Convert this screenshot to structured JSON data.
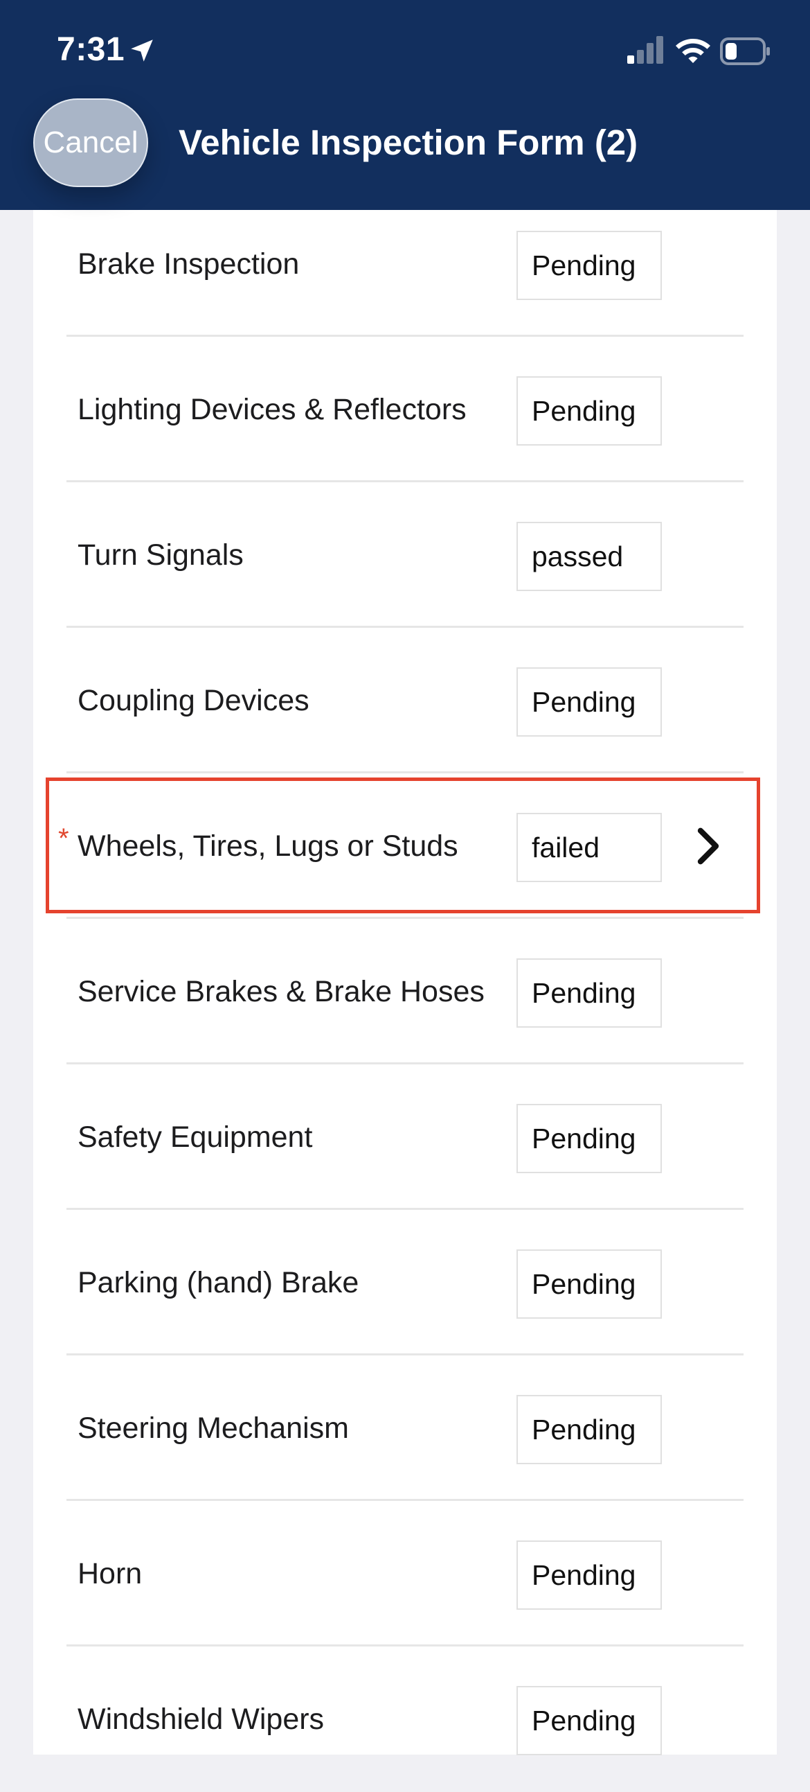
{
  "status_bar": {
    "time": "7:31",
    "icons": [
      "location-arrow-icon",
      "cellular-signal-icon",
      "wifi-icon",
      "battery-icon"
    ]
  },
  "header": {
    "cancel_label": "Cancel",
    "title": "Vehicle Inspection Form (2)",
    "background_color": "#122f5e"
  },
  "items": [
    {
      "label": "Brake Inspection",
      "status": "Pending"
    },
    {
      "label": "Lighting Devices & Reflectors",
      "status": "Pending"
    },
    {
      "label": "Turn Signals",
      "status": "passed"
    },
    {
      "label": "Coupling Devices",
      "status": "Pending"
    },
    {
      "label": "Wheels, Tires, Lugs or Studs",
      "status": "failed",
      "required_mark": "*",
      "highlighted": true
    },
    {
      "label": "Service Brakes & Brake Hoses",
      "status": "Pending"
    },
    {
      "label": "Safety Equipment",
      "status": "Pending"
    },
    {
      "label": "Parking (hand) Brake",
      "status": "Pending"
    },
    {
      "label": "Steering Mechanism",
      "status": "Pending"
    },
    {
      "label": "Horn",
      "status": "Pending"
    },
    {
      "label": "Windshield Wipers",
      "status": "Pending"
    }
  ],
  "colors": {
    "highlight": "#e5432e",
    "required": "#e0472f",
    "page_background": "#f0f0f4"
  }
}
